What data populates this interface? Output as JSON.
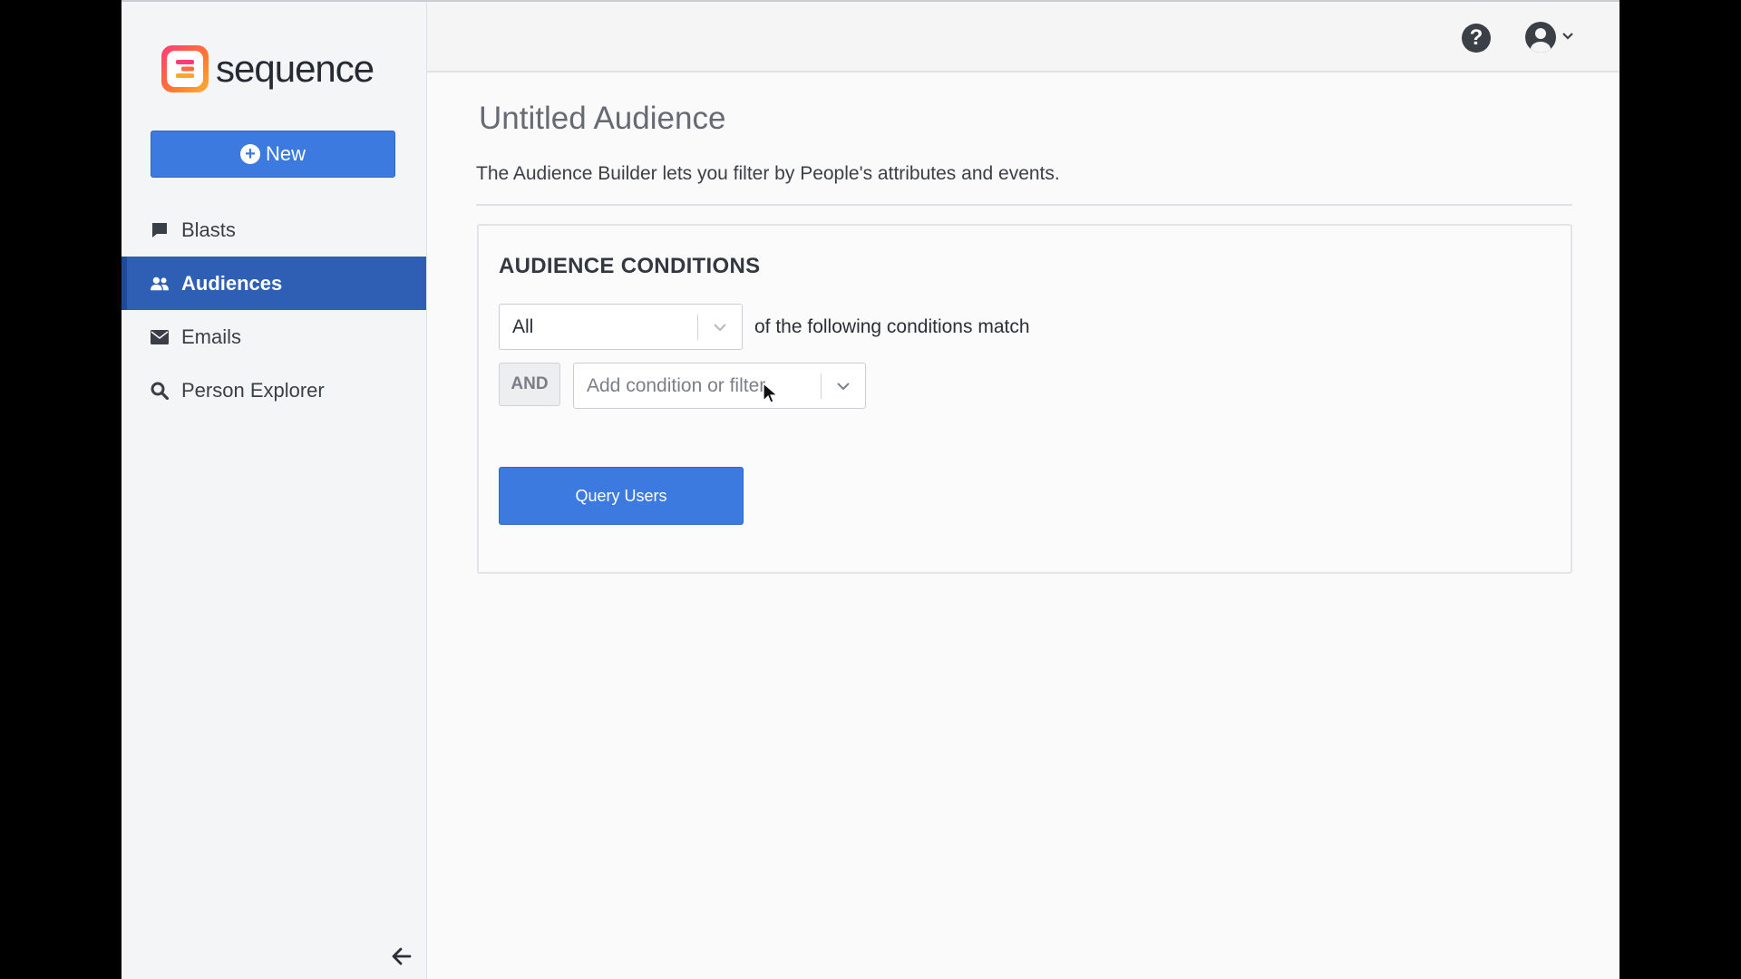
{
  "app": {
    "brand": "sequence"
  },
  "sidebar": {
    "new_label": "New",
    "items": [
      {
        "label": "Blasts",
        "icon": "chat-icon",
        "active": false
      },
      {
        "label": "Audiences",
        "icon": "users-icon",
        "active": true
      },
      {
        "label": "Emails",
        "icon": "envelope-icon",
        "active": false
      },
      {
        "label": "Person Explorer",
        "icon": "search-icon",
        "active": false
      }
    ],
    "collapse_icon": "arrow-left-icon"
  },
  "header": {
    "help_icon": "question-circle-icon",
    "user_icon": "user-circle-icon"
  },
  "main": {
    "title": "Untitled Audience",
    "description": "The Audience Builder lets you filter by People's attributes and events.",
    "panel": {
      "title": "AUDIENCE CONDITIONS",
      "match_select_value": "All",
      "match_text": "of the following conditions match",
      "and_label": "AND",
      "condition_placeholder": "Add condition or filter",
      "query_button": "Query Users"
    }
  },
  "colors": {
    "accent": "#3c7ae0",
    "active_nav": "#2e5fb5"
  }
}
